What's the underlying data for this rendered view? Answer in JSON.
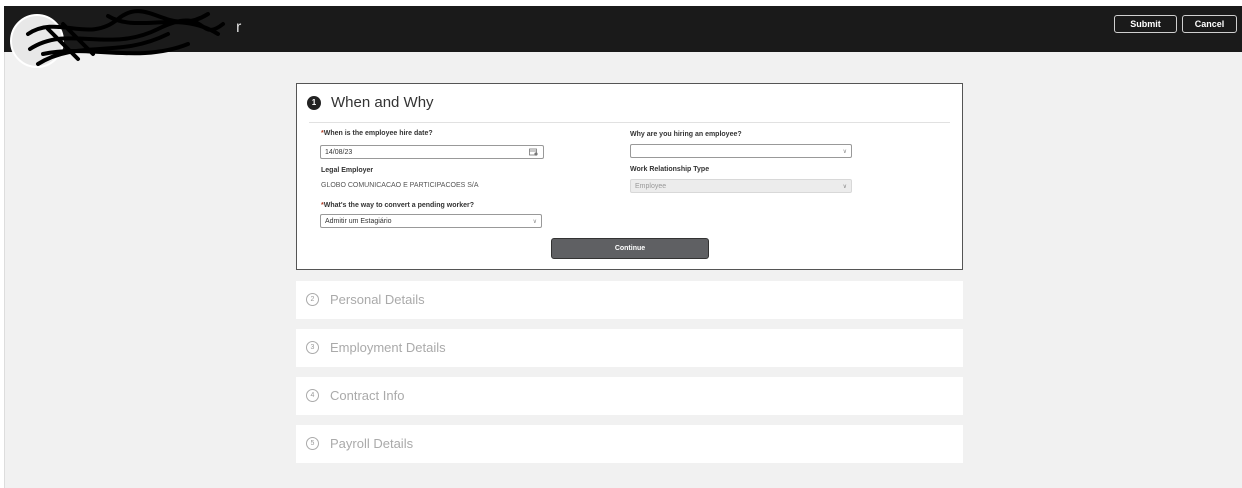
{
  "header": {
    "title_fragment": "r",
    "submit_label": "Submit",
    "cancel_label": "Cancel"
  },
  "step1": {
    "number": "1",
    "title": "When and Why",
    "hire_date_label": "When is the employee hire date?",
    "hire_date_value": "14/08/23",
    "why_label": "Why are you hiring an employee?",
    "why_value": "",
    "legal_employer_label": "Legal Employer",
    "legal_employer_value": "GLOBO COMUNICACAO E PARTICIPACOES S/A",
    "work_rel_label": "Work Relationship Type",
    "work_rel_value": "Employee",
    "convert_label": "What's the way to convert a pending worker?",
    "convert_value": "Admitir um Estagiário",
    "required_mark": "*",
    "continue_label": "Continue"
  },
  "steps": [
    {
      "number": "2",
      "title": "Personal Details"
    },
    {
      "number": "3",
      "title": "Employment Details"
    },
    {
      "number": "4",
      "title": "Contract Info"
    },
    {
      "number": "5",
      "title": "Payroll Details"
    }
  ],
  "icons": {
    "chevron": "chevron-down-icon",
    "calendar": "calendar-icon"
  },
  "colors": {
    "header_bg": "#1a1a1a",
    "continue_bg": "#5f6063",
    "required": "#b0402a"
  }
}
